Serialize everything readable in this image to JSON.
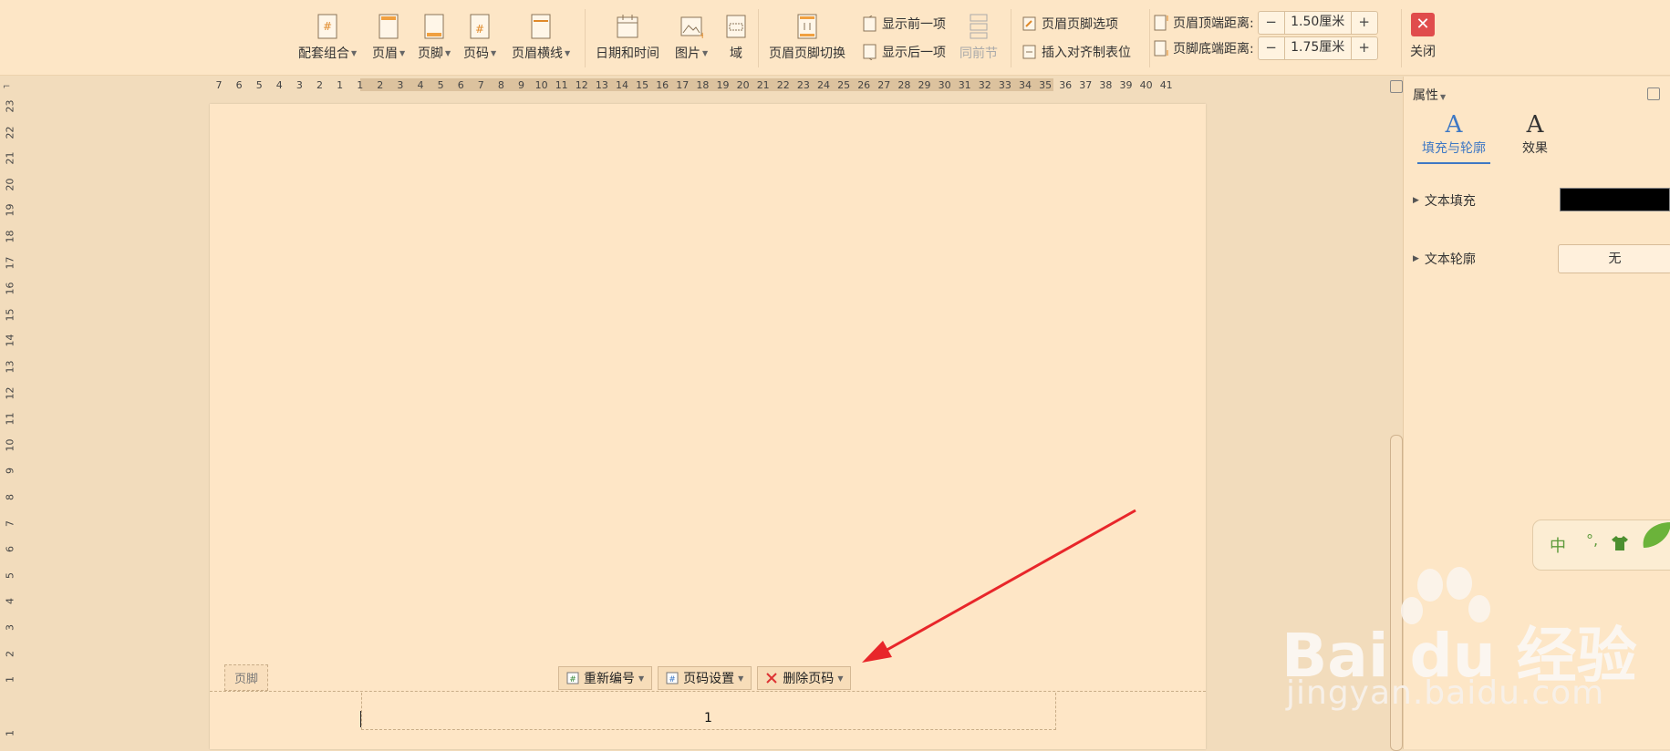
{
  "ribbon": {
    "set_combo": "配套组合",
    "header": "页眉",
    "footer": "页脚",
    "page_number": "页码",
    "header_line": "页眉横线",
    "date_time": "日期和时间",
    "picture": "图片",
    "field": "域",
    "switch_header_footer": "页眉页脚切换",
    "show_prev": "显示前一项",
    "show_next": "显示后一项",
    "same_as_prev": "同前节",
    "header_footer_options": "页眉页脚选项",
    "insert_align_tab": "插入对齐制表位",
    "header_top_label": "页眉顶端距离:",
    "header_top_value": "1.50厘米",
    "footer_bottom_label": "页脚底端距离:",
    "footer_bottom_value": "1.75厘米",
    "minus": "−",
    "plus": "+",
    "close": "关闭"
  },
  "hruler_ticks": [
    "7",
    "6",
    "5",
    "4",
    "3",
    "2",
    "1",
    "1",
    "2",
    "3",
    "4",
    "5",
    "6",
    "7",
    "8",
    "9",
    "10",
    "11",
    "12",
    "13",
    "14",
    "15",
    "16",
    "17",
    "18",
    "19",
    "20",
    "21",
    "22",
    "23",
    "24",
    "25",
    "26",
    "27",
    "28",
    "29",
    "30",
    "31",
    "32",
    "33",
    "34",
    "35",
    "36",
    "37",
    "38",
    "39",
    "40",
    "41"
  ],
  "vruler_ticks": [
    "23",
    "22",
    "21",
    "20",
    "19",
    "18",
    "17",
    "16",
    "15",
    "14",
    "13",
    "12",
    "11",
    "10",
    "9",
    "8",
    "7",
    "6",
    "5",
    "4",
    "3",
    "2",
    "1",
    "1"
  ],
  "document": {
    "footer_tag": "页脚",
    "renumber": "重新编号",
    "page_number_settings": "页码设置",
    "delete_page_number": "删除页码",
    "page_number_value": "1"
  },
  "panel": {
    "title": "属性",
    "tab_fill_outline": "填充与轮廓",
    "tab_effect": "效果",
    "tab_glyph": "A",
    "text_fill": "文本填充",
    "text_outline": "文本轮廓",
    "outline_value": "无",
    "fill_color": "#000000"
  },
  "ime": {
    "mode": "中",
    "punct": "°,"
  },
  "watermark": {
    "brand": "Bai du 经验",
    "url": "jingyan.baidu.com"
  },
  "colors": {
    "accent": "#3e78c4",
    "close": "#e04c4c",
    "arrow": "#e8262a"
  }
}
